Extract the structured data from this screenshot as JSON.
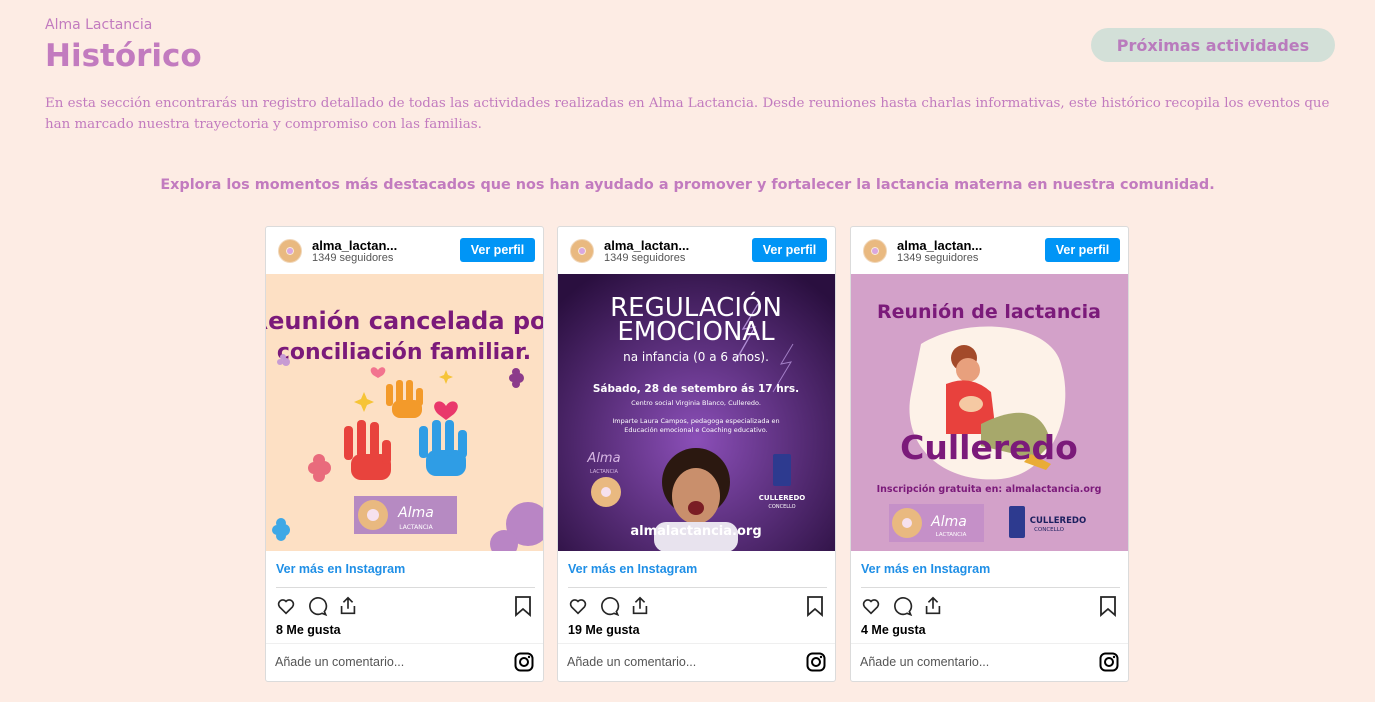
{
  "header": {
    "brand": "Alma Lactancia",
    "title": "Histórico",
    "next_button": "Próximas actividades"
  },
  "intro": {
    "description": "En esta sección encontrarás un registro detallado de todas las actividades realizadas en Alma Lactancia. Desde reuniones hasta charlas informativas, este histórico recopila los eventos que han marcado nuestra trayectoria y compromiso con las familias.",
    "lead": "Explora los momentos más destacados que nos han ayudado a promover y fortalecer la lactancia materna en nuestra comunidad."
  },
  "colors": {
    "background": "#fdece4",
    "accent": "#c27bbf",
    "button_bg": "#d3e0d8",
    "instagram_blue": "#0095f6"
  },
  "posts": [
    {
      "username": "alma_lactan...",
      "followers": "1349 seguidores",
      "profile_button": "Ver perfil",
      "more_link": "Ver más en Instagram",
      "likes": "8 Me gusta",
      "comment_placeholder": "Añade un comentario...",
      "image": {
        "line1": "Reunión cancelada por",
        "line2": "conciliación familiar.",
        "logo_text": "Alma",
        "logo_sub": "LACTANCIA"
      }
    },
    {
      "username": "alma_lactan...",
      "followers": "1349 seguidores",
      "profile_button": "Ver perfil",
      "more_link": "Ver más en Instagram",
      "likes": "19 Me gusta",
      "comment_placeholder": "Añade un comentario...",
      "image": {
        "title1": "REGULACIÓN",
        "title2": "EMOCIONAL",
        "subtitle": "na infancia (0 a 6 anos).",
        "date": "Sábado, 28 de setembro ás 17 hrs.",
        "place": "Centro social Virginia Blanco, Culleredo.",
        "speaker1": "Imparte Laura Campos, pedagoga especializada en",
        "speaker2": "Educación emocional e Coaching educativo.",
        "logo_text": "Alma",
        "logo_sub": "LACTANCIA",
        "council": "CULLEREDO",
        "council_sub": "CONCELLO",
        "url": "almalactancia.org"
      }
    },
    {
      "username": "alma_lactan...",
      "followers": "1349 seguidores",
      "profile_button": "Ver perfil",
      "more_link": "Ver más en Instagram",
      "likes": "4 Me gusta",
      "comment_placeholder": "Añade un comentario...",
      "image": {
        "title": "Reunión de lactancia",
        "place": "Culleredo",
        "signup": "Inscripción gratuita en: almalactancia.org",
        "logo_text": "Alma",
        "logo_sub": "LACTANCIA",
        "council": "CULLEREDO",
        "council_sub": "CONCELLO"
      }
    }
  ]
}
